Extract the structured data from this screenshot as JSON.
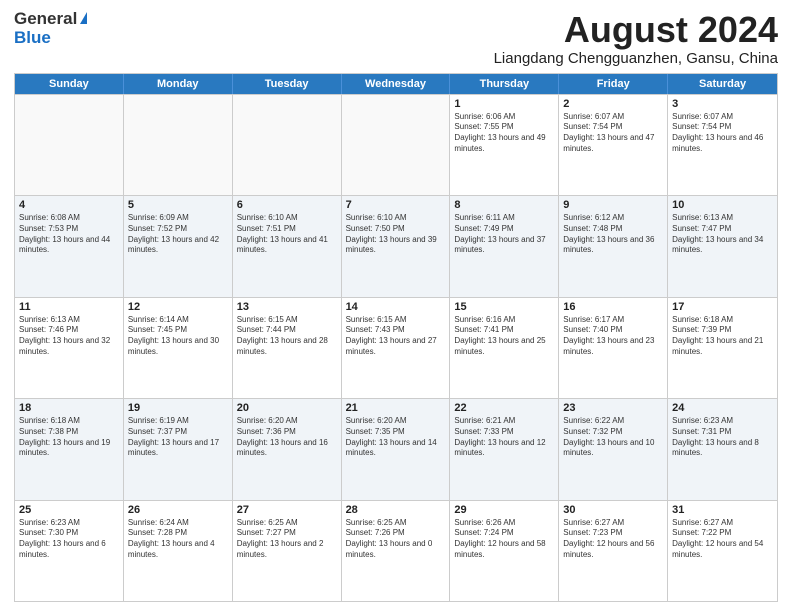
{
  "logo": {
    "general": "General",
    "blue": "Blue"
  },
  "header": {
    "month": "August 2024",
    "location": "Liangdang Chengguanzhen, Gansu, China"
  },
  "weekdays": [
    "Sunday",
    "Monday",
    "Tuesday",
    "Wednesday",
    "Thursday",
    "Friday",
    "Saturday"
  ],
  "weeks": [
    [
      {
        "day": "",
        "info": ""
      },
      {
        "day": "",
        "info": ""
      },
      {
        "day": "",
        "info": ""
      },
      {
        "day": "",
        "info": ""
      },
      {
        "day": "1",
        "info": "Sunrise: 6:06 AM\nSunset: 7:55 PM\nDaylight: 13 hours and 49 minutes."
      },
      {
        "day": "2",
        "info": "Sunrise: 6:07 AM\nSunset: 7:54 PM\nDaylight: 13 hours and 47 minutes."
      },
      {
        "day": "3",
        "info": "Sunrise: 6:07 AM\nSunset: 7:54 PM\nDaylight: 13 hours and 46 minutes."
      }
    ],
    [
      {
        "day": "4",
        "info": "Sunrise: 6:08 AM\nSunset: 7:53 PM\nDaylight: 13 hours and 44 minutes."
      },
      {
        "day": "5",
        "info": "Sunrise: 6:09 AM\nSunset: 7:52 PM\nDaylight: 13 hours and 42 minutes."
      },
      {
        "day": "6",
        "info": "Sunrise: 6:10 AM\nSunset: 7:51 PM\nDaylight: 13 hours and 41 minutes."
      },
      {
        "day": "7",
        "info": "Sunrise: 6:10 AM\nSunset: 7:50 PM\nDaylight: 13 hours and 39 minutes."
      },
      {
        "day": "8",
        "info": "Sunrise: 6:11 AM\nSunset: 7:49 PM\nDaylight: 13 hours and 37 minutes."
      },
      {
        "day": "9",
        "info": "Sunrise: 6:12 AM\nSunset: 7:48 PM\nDaylight: 13 hours and 36 minutes."
      },
      {
        "day": "10",
        "info": "Sunrise: 6:13 AM\nSunset: 7:47 PM\nDaylight: 13 hours and 34 minutes."
      }
    ],
    [
      {
        "day": "11",
        "info": "Sunrise: 6:13 AM\nSunset: 7:46 PM\nDaylight: 13 hours and 32 minutes."
      },
      {
        "day": "12",
        "info": "Sunrise: 6:14 AM\nSunset: 7:45 PM\nDaylight: 13 hours and 30 minutes."
      },
      {
        "day": "13",
        "info": "Sunrise: 6:15 AM\nSunset: 7:44 PM\nDaylight: 13 hours and 28 minutes."
      },
      {
        "day": "14",
        "info": "Sunrise: 6:15 AM\nSunset: 7:43 PM\nDaylight: 13 hours and 27 minutes."
      },
      {
        "day": "15",
        "info": "Sunrise: 6:16 AM\nSunset: 7:41 PM\nDaylight: 13 hours and 25 minutes."
      },
      {
        "day": "16",
        "info": "Sunrise: 6:17 AM\nSunset: 7:40 PM\nDaylight: 13 hours and 23 minutes."
      },
      {
        "day": "17",
        "info": "Sunrise: 6:18 AM\nSunset: 7:39 PM\nDaylight: 13 hours and 21 minutes."
      }
    ],
    [
      {
        "day": "18",
        "info": "Sunrise: 6:18 AM\nSunset: 7:38 PM\nDaylight: 13 hours and 19 minutes."
      },
      {
        "day": "19",
        "info": "Sunrise: 6:19 AM\nSunset: 7:37 PM\nDaylight: 13 hours and 17 minutes."
      },
      {
        "day": "20",
        "info": "Sunrise: 6:20 AM\nSunset: 7:36 PM\nDaylight: 13 hours and 16 minutes."
      },
      {
        "day": "21",
        "info": "Sunrise: 6:20 AM\nSunset: 7:35 PM\nDaylight: 13 hours and 14 minutes."
      },
      {
        "day": "22",
        "info": "Sunrise: 6:21 AM\nSunset: 7:33 PM\nDaylight: 13 hours and 12 minutes."
      },
      {
        "day": "23",
        "info": "Sunrise: 6:22 AM\nSunset: 7:32 PM\nDaylight: 13 hours and 10 minutes."
      },
      {
        "day": "24",
        "info": "Sunrise: 6:23 AM\nSunset: 7:31 PM\nDaylight: 13 hours and 8 minutes."
      }
    ],
    [
      {
        "day": "25",
        "info": "Sunrise: 6:23 AM\nSunset: 7:30 PM\nDaylight: 13 hours and 6 minutes."
      },
      {
        "day": "26",
        "info": "Sunrise: 6:24 AM\nSunset: 7:28 PM\nDaylight: 13 hours and 4 minutes."
      },
      {
        "day": "27",
        "info": "Sunrise: 6:25 AM\nSunset: 7:27 PM\nDaylight: 13 hours and 2 minutes."
      },
      {
        "day": "28",
        "info": "Sunrise: 6:25 AM\nSunset: 7:26 PM\nDaylight: 13 hours and 0 minutes."
      },
      {
        "day": "29",
        "info": "Sunrise: 6:26 AM\nSunset: 7:24 PM\nDaylight: 12 hours and 58 minutes."
      },
      {
        "day": "30",
        "info": "Sunrise: 6:27 AM\nSunset: 7:23 PM\nDaylight: 12 hours and 56 minutes."
      },
      {
        "day": "31",
        "info": "Sunrise: 6:27 AM\nSunset: 7:22 PM\nDaylight: 12 hours and 54 minutes."
      }
    ]
  ]
}
